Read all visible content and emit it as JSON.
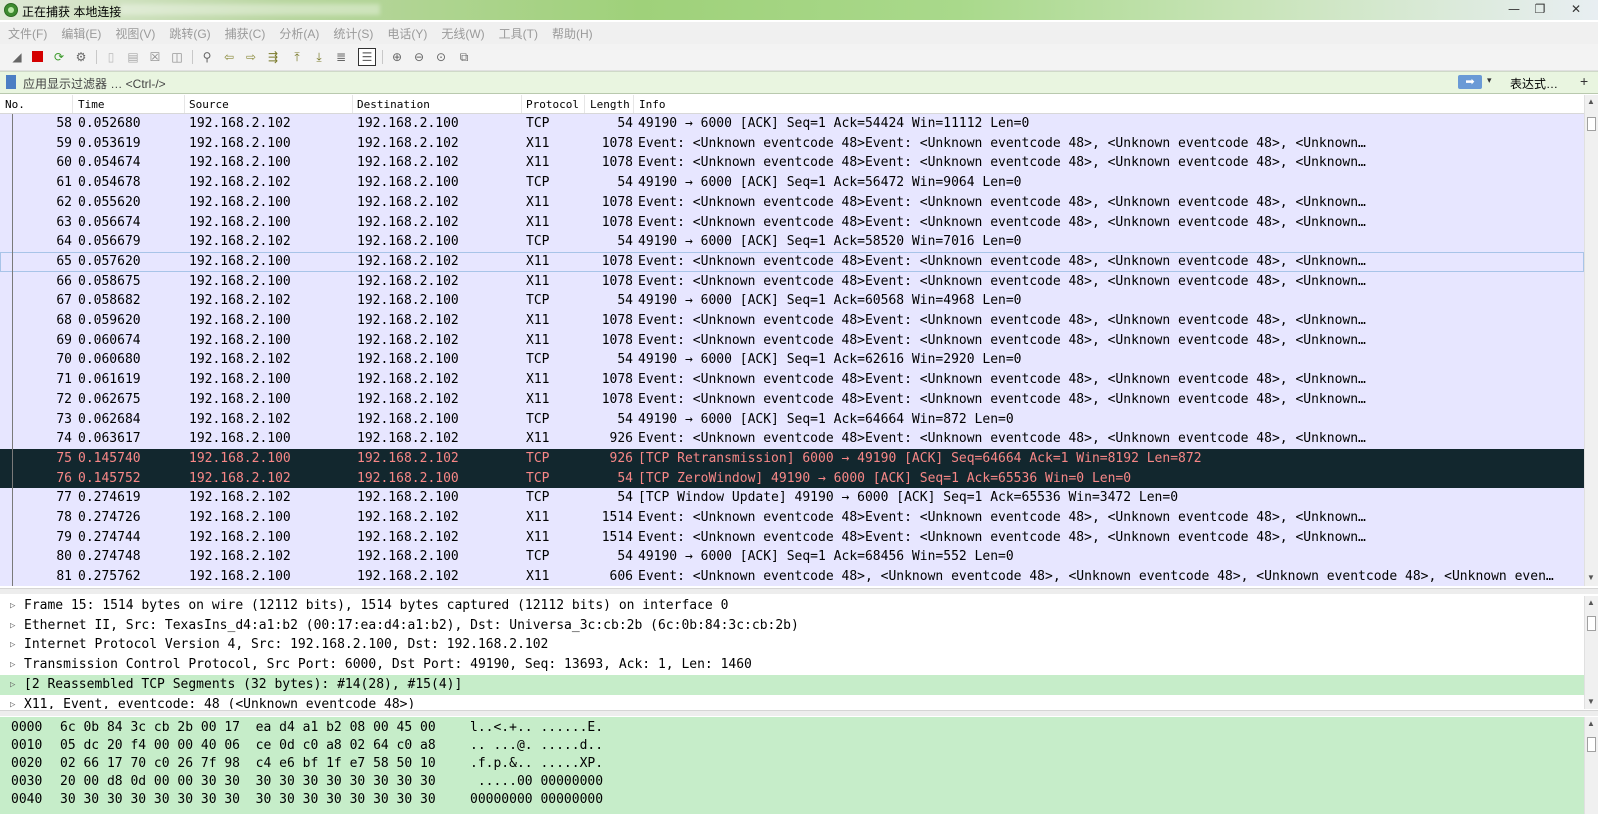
{
  "window": {
    "title": "正在捕获 本地连接",
    "controls": {
      "minimize": "—",
      "restore": "❐",
      "close": "✕"
    }
  },
  "menu": [
    "文件(F)",
    "编辑(E)",
    "视图(V)",
    "跳转(G)",
    "捕获(C)",
    "分析(A)",
    "统计(S)",
    "电话(Y)",
    "无线(W)",
    "工具(T)",
    "帮助(H)"
  ],
  "toolbar_icons": [
    "shark-fin-start-icon",
    "stop-capture-icon",
    "restart-capture-icon",
    "capture-options-icon",
    "open-file-icon",
    "save-file-icon",
    "close-file-icon",
    "reload-file-icon",
    "find-packet-icon",
    "go-back-icon",
    "go-forward-icon",
    "go-to-packet-icon",
    "go-first-icon",
    "go-last-icon",
    "auto-scroll-icon",
    "colorize-icon",
    "zoom-in-icon",
    "zoom-out-icon",
    "zoom-normal-icon",
    "resize-columns-icon"
  ],
  "filter": {
    "placeholder": "应用显示过滤器 … <Ctrl-/>",
    "apply_glyph": "➡",
    "dropdown_glyph": "▾",
    "expression_label": "表达式…",
    "add_label": "+"
  },
  "columns": {
    "no": "No.",
    "time": "Time",
    "source": "Source",
    "destination": "Destination",
    "protocol": "Protocol",
    "length": "Length",
    "info": "Info"
  },
  "packets": [
    {
      "no": "58",
      "time": "0.052680",
      "src": "192.168.2.102",
      "dst": "192.168.2.100",
      "proto": "TCP",
      "len": "54",
      "info": "49190 → 6000 [ACK] Seq=1 Ack=54424 Win=11112 Len=0"
    },
    {
      "no": "59",
      "time": "0.053619",
      "src": "192.168.2.100",
      "dst": "192.168.2.102",
      "proto": "X11",
      "len": "1078",
      "info": "Event: <Unknown eventcode 48>Event: <Unknown eventcode 48>, <Unknown eventcode 48>, <Unknown…"
    },
    {
      "no": "60",
      "time": "0.054674",
      "src": "192.168.2.100",
      "dst": "192.168.2.102",
      "proto": "X11",
      "len": "1078",
      "info": "Event: <Unknown eventcode 48>Event: <Unknown eventcode 48>, <Unknown eventcode 48>, <Unknown…"
    },
    {
      "no": "61",
      "time": "0.054678",
      "src": "192.168.2.102",
      "dst": "192.168.2.100",
      "proto": "TCP",
      "len": "54",
      "info": "49190 → 6000 [ACK] Seq=1 Ack=56472 Win=9064 Len=0"
    },
    {
      "no": "62",
      "time": "0.055620",
      "src": "192.168.2.100",
      "dst": "192.168.2.102",
      "proto": "X11",
      "len": "1078",
      "info": "Event: <Unknown eventcode 48>Event: <Unknown eventcode 48>, <Unknown eventcode 48>, <Unknown…"
    },
    {
      "no": "63",
      "time": "0.056674",
      "src": "192.168.2.100",
      "dst": "192.168.2.102",
      "proto": "X11",
      "len": "1078",
      "info": "Event: <Unknown eventcode 48>Event: <Unknown eventcode 48>, <Unknown eventcode 48>, <Unknown…"
    },
    {
      "no": "64",
      "time": "0.056679",
      "src": "192.168.2.102",
      "dst": "192.168.2.100",
      "proto": "TCP",
      "len": "54",
      "info": "49190 → 6000 [ACK] Seq=1 Ack=58520 Win=7016 Len=0"
    },
    {
      "no": "65",
      "time": "0.057620",
      "src": "192.168.2.100",
      "dst": "192.168.2.102",
      "proto": "X11",
      "len": "1078",
      "info": "Event: <Unknown eventcode 48>Event: <Unknown eventcode 48>, <Unknown eventcode 48>, <Unknown…"
    },
    {
      "no": "66",
      "time": "0.058675",
      "src": "192.168.2.100",
      "dst": "192.168.2.102",
      "proto": "X11",
      "len": "1078",
      "info": "Event: <Unknown eventcode 48>Event: <Unknown eventcode 48>, <Unknown eventcode 48>, <Unknown…"
    },
    {
      "no": "67",
      "time": "0.058682",
      "src": "192.168.2.102",
      "dst": "192.168.2.100",
      "proto": "TCP",
      "len": "54",
      "info": "49190 → 6000 [ACK] Seq=1 Ack=60568 Win=4968 Len=0"
    },
    {
      "no": "68",
      "time": "0.059620",
      "src": "192.168.2.100",
      "dst": "192.168.2.102",
      "proto": "X11",
      "len": "1078",
      "info": "Event: <Unknown eventcode 48>Event: <Unknown eventcode 48>, <Unknown eventcode 48>, <Unknown…"
    },
    {
      "no": "69",
      "time": "0.060674",
      "src": "192.168.2.100",
      "dst": "192.168.2.102",
      "proto": "X11",
      "len": "1078",
      "info": "Event: <Unknown eventcode 48>Event: <Unknown eventcode 48>, <Unknown eventcode 48>, <Unknown…"
    },
    {
      "no": "70",
      "time": "0.060680",
      "src": "192.168.2.102",
      "dst": "192.168.2.100",
      "proto": "TCP",
      "len": "54",
      "info": "49190 → 6000 [ACK] Seq=1 Ack=62616 Win=2920 Len=0"
    },
    {
      "no": "71",
      "time": "0.061619",
      "src": "192.168.2.100",
      "dst": "192.168.2.102",
      "proto": "X11",
      "len": "1078",
      "info": "Event: <Unknown eventcode 48>Event: <Unknown eventcode 48>, <Unknown eventcode 48>, <Unknown…"
    },
    {
      "no": "72",
      "time": "0.062675",
      "src": "192.168.2.100",
      "dst": "192.168.2.102",
      "proto": "X11",
      "len": "1078",
      "info": "Event: <Unknown eventcode 48>Event: <Unknown eventcode 48>, <Unknown eventcode 48>, <Unknown…"
    },
    {
      "no": "73",
      "time": "0.062684",
      "src": "192.168.2.102",
      "dst": "192.168.2.100",
      "proto": "TCP",
      "len": "54",
      "info": "49190 → 6000 [ACK] Seq=1 Ack=64664 Win=872 Len=0"
    },
    {
      "no": "74",
      "time": "0.063617",
      "src": "192.168.2.100",
      "dst": "192.168.2.102",
      "proto": "X11",
      "len": "926",
      "info": "Event: <Unknown eventcode 48>Event: <Unknown eventcode 48>, <Unknown eventcode 48>, <Unknown…"
    },
    {
      "no": "75",
      "time": "0.145740",
      "src": "192.168.2.100",
      "dst": "192.168.2.102",
      "proto": "TCP",
      "len": "926",
      "info": "[TCP Retransmission] 6000 → 49190 [ACK] Seq=64664 Ack=1 Win=8192 Len=872",
      "bad": true
    },
    {
      "no": "76",
      "time": "0.145752",
      "src": "192.168.2.102",
      "dst": "192.168.2.100",
      "proto": "TCP",
      "len": "54",
      "info": "[TCP ZeroWindow] 49190 → 6000 [ACK] Seq=1 Ack=65536 Win=0 Len=0",
      "bad": true
    },
    {
      "no": "77",
      "time": "0.274619",
      "src": "192.168.2.102",
      "dst": "192.168.2.100",
      "proto": "TCP",
      "len": "54",
      "info": "[TCP Window Update] 49190 → 6000 [ACK] Seq=1 Ack=65536 Win=3472 Len=0"
    },
    {
      "no": "78",
      "time": "0.274726",
      "src": "192.168.2.100",
      "dst": "192.168.2.102",
      "proto": "X11",
      "len": "1514",
      "info": "Event: <Unknown eventcode 48>Event: <Unknown eventcode 48>, <Unknown eventcode 48>, <Unknown…"
    },
    {
      "no": "79",
      "time": "0.274744",
      "src": "192.168.2.100",
      "dst": "192.168.2.102",
      "proto": "X11",
      "len": "1514",
      "info": "Event: <Unknown eventcode 48>Event: <Unknown eventcode 48>, <Unknown eventcode 48>, <Unknown…"
    },
    {
      "no": "80",
      "time": "0.274748",
      "src": "192.168.2.102",
      "dst": "192.168.2.100",
      "proto": "TCP",
      "len": "54",
      "info": "49190 → 6000 [ACK] Seq=1 Ack=68456 Win=552 Len=0"
    },
    {
      "no": "81",
      "time": "0.275762",
      "src": "192.168.2.100",
      "dst": "192.168.2.102",
      "proto": "X11",
      "len": "606",
      "info": "Event: <Unknown eventcode 48>, <Unknown eventcode 48>, <Unknown eventcode 48>, <Unknown eventcode 48>, <Unknown even…"
    }
  ],
  "details": [
    {
      "text": "Frame 15: 1514 bytes on wire (12112 bits), 1514 bytes captured (12112 bits) on interface 0"
    },
    {
      "text": "Ethernet II, Src: TexasIns_d4:a1:b2 (00:17:ea:d4:a1:b2), Dst: Universa_3c:cb:2b (6c:0b:84:3c:cb:2b)"
    },
    {
      "text": "Internet Protocol Version 4, Src: 192.168.2.100, Dst: 192.168.2.102"
    },
    {
      "text": "Transmission Control Protocol, Src Port: 6000, Dst Port: 49190, Seq: 13693, Ack: 1, Len: 1460"
    },
    {
      "text": "[2 Reassembled TCP Segments (32 bytes): #14(28), #15(4)]",
      "highlight": true
    },
    {
      "text": "X11, Event, eventcode: 48 (<Unknown eventcode 48>)"
    }
  ],
  "bytes": [
    {
      "offset": "0000",
      "hex": "6c 0b 84 3c cb 2b 00 17  ea d4 a1 b2 08 00 45 00",
      "ascii": "l..<.+.. ......E."
    },
    {
      "offset": "0010",
      "hex": "05 dc 20 f4 00 00 40 06  ce 0d c0 a8 02 64 c0 a8",
      "ascii": ".. ...@. .....d.."
    },
    {
      "offset": "0020",
      "hex": "02 66 17 70 c0 26 7f 98  c4 e6 bf 1f e7 58 50 10",
      "ascii": ".f.p.&.. .....XP."
    },
    {
      "offset": "0030",
      "hex": "20 00 d8 0d 00 00 30 30  30 30 30 30 30 30 30 30",
      "ascii": " .....00 00000000"
    },
    {
      "offset": "0040",
      "hex": "30 30 30 30 30 30 30 30  30 30 30 30 30 30 30 30",
      "ascii": "00000000 00000000"
    }
  ],
  "colors": {
    "row_bg": "#e7e6ff",
    "bad_row_bg": "#12272e",
    "bad_row_text": "#f78787",
    "highlight_green": "#c6edc9",
    "filter_bg": "#e9f5e0"
  }
}
